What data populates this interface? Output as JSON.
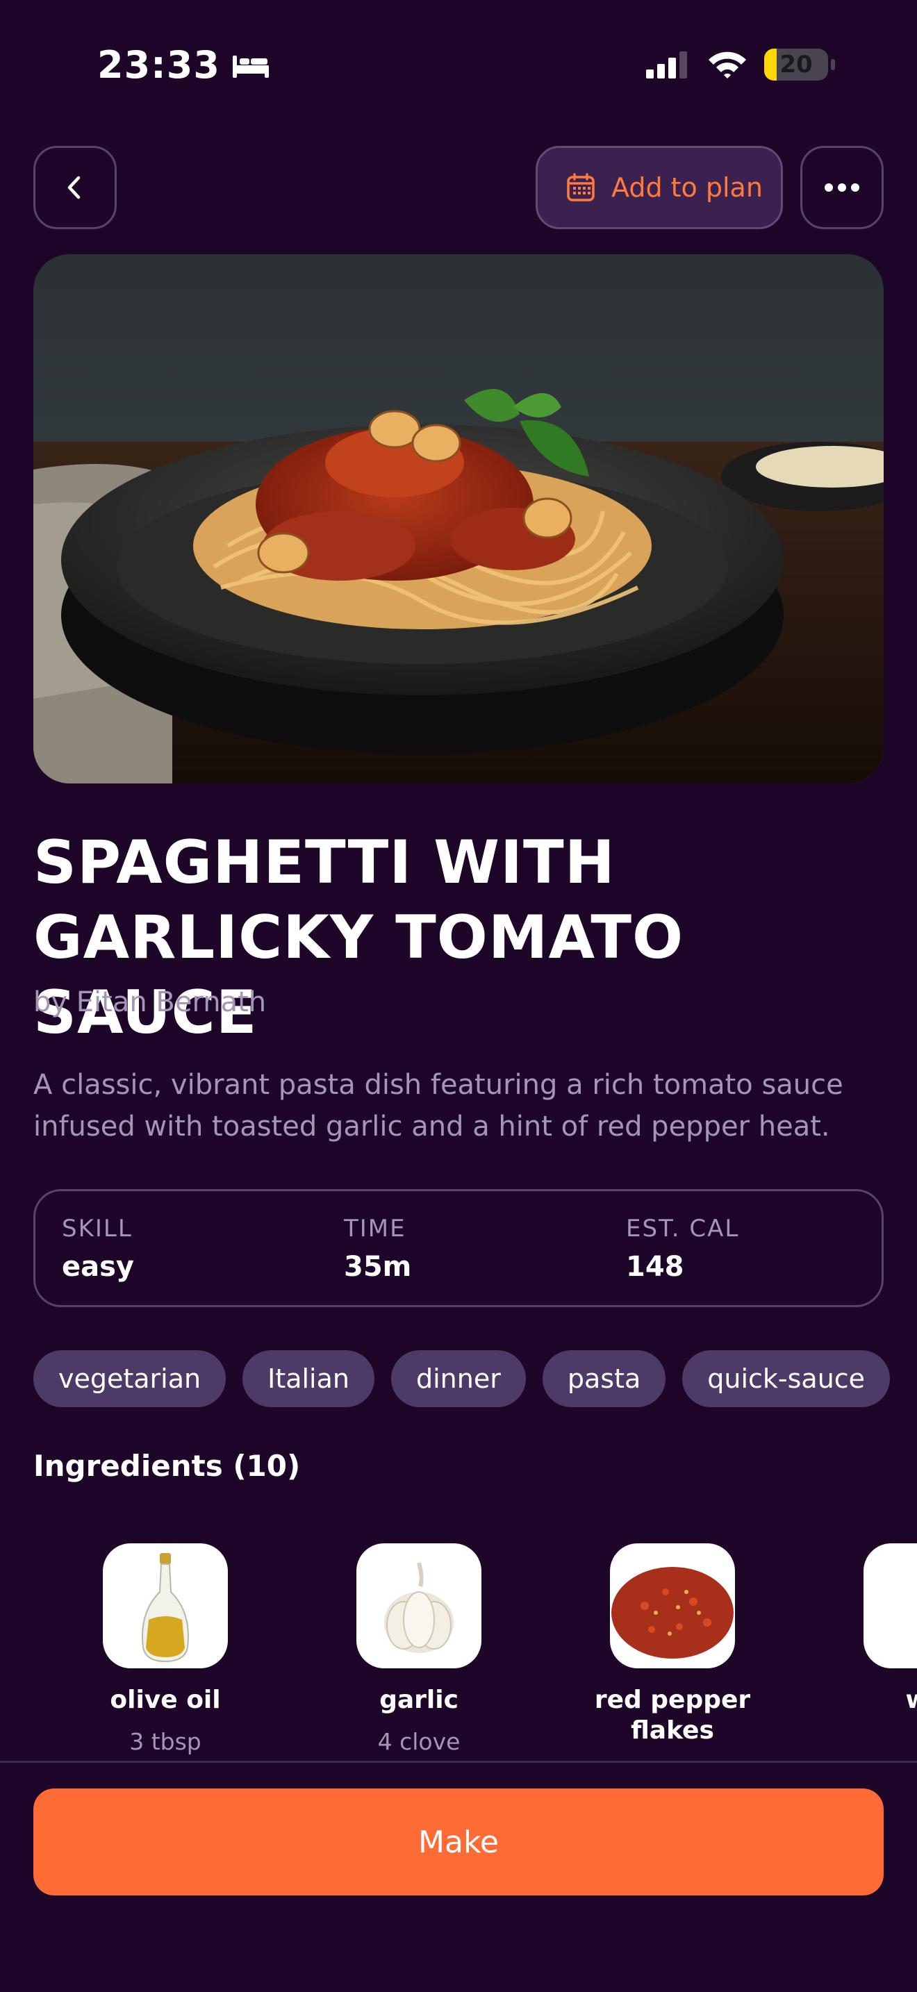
{
  "status_bar": {
    "time": "23:33",
    "battery": "20",
    "battery_level": 0.2
  },
  "header": {
    "add_to_plan_label": "Add to plan"
  },
  "recipe": {
    "title": "SPAGHETTI WITH GARLICKY TOMATO SAUCE",
    "author": "by Eitan Bernath",
    "description": "A classic, vibrant pasta dish featuring a rich tomato sauce infused with toasted garlic and a hint of red pepper heat."
  },
  "stats": [
    {
      "label": "SKILL",
      "value": "easy"
    },
    {
      "label": "TIME",
      "value": "35m"
    },
    {
      "label": "EST. CAL",
      "value": "148"
    }
  ],
  "tags": [
    "vegetarian",
    "Italian",
    "dinner",
    "pasta",
    "quick-sauce"
  ],
  "ingredients_heading": "Ingredients (10)",
  "ingredients": [
    {
      "name": "olive oil",
      "amount": "3 tbsp"
    },
    {
      "name": "garlic",
      "amount": "4 clove"
    },
    {
      "name": "red pepper flakes",
      "amount": ""
    },
    {
      "name": "wh",
      "amount": ""
    }
  ],
  "make_label": "Make",
  "colors": {
    "background": "#1e0628",
    "accent": "#ff6b35",
    "chip": "#4d3a66",
    "muted_text": "#a396b8"
  }
}
